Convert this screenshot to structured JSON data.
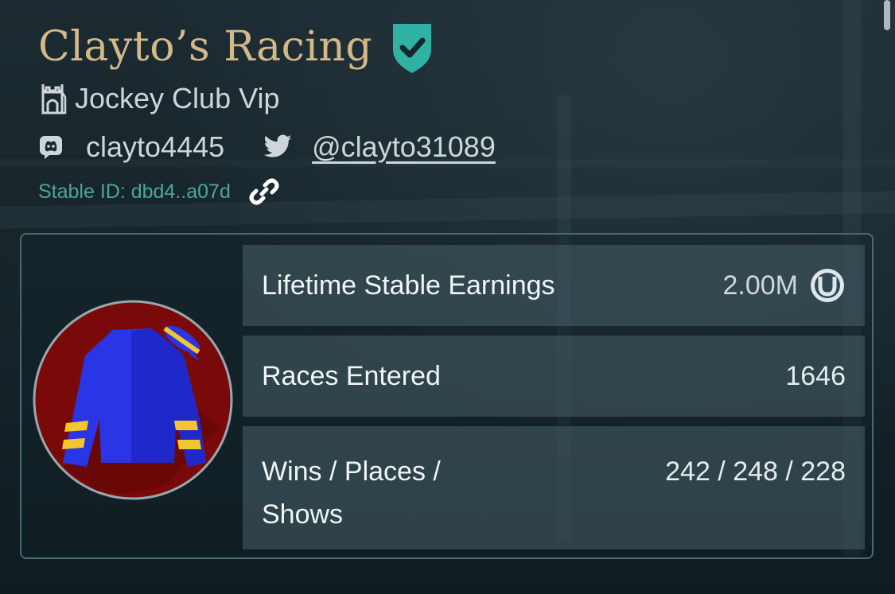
{
  "header": {
    "title": "Clayto’s Racing",
    "club": "Jockey Club Vip",
    "discord": "clayto4445",
    "twitter": "@clayto31089",
    "stable_id": "Stable ID: dbd4..a07d"
  },
  "icons": {
    "verified": "verified-shield-icon",
    "club": "castle-tower-icon",
    "discord": "discord-icon",
    "twitter": "twitter-bird-icon",
    "link": "link-icon",
    "coin": "horseshoe-coin-icon"
  },
  "colors": {
    "title": "#d3b988",
    "accent_teal": "#2fb1a3",
    "stable_id": "#4aa69b",
    "silks_background": "#7a0a0a",
    "silks_jacket": "#2a35e6",
    "silks_stripe": "#f2c62e"
  },
  "stats": [
    {
      "label": "Lifetime Stable Earnings",
      "value": "2.00M"
    },
    {
      "label": "Races Entered",
      "value": "1646"
    },
    {
      "label": "Wins / Places / Shows",
      "value": "242 / 248 / 228"
    }
  ]
}
